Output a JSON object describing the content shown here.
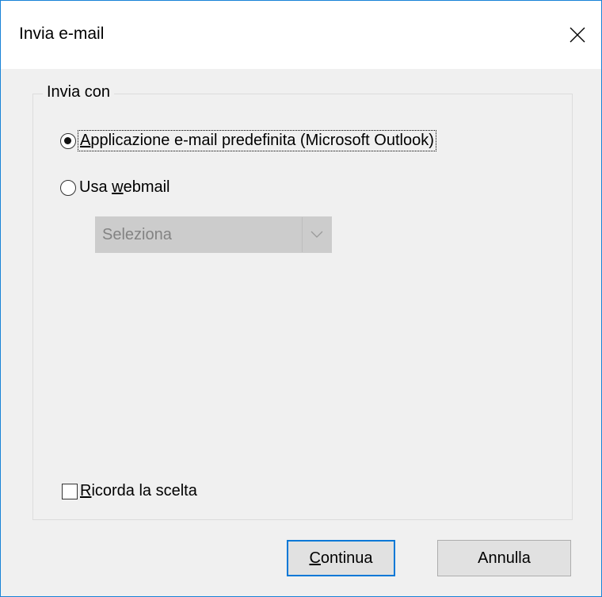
{
  "dialog": {
    "title": "Invia e-mail",
    "close_icon": "close-icon"
  },
  "send_with": {
    "legend": "Invia con",
    "options": [
      {
        "label_underlined": "A",
        "label_rest": "pplicazione e-mail predefinita (Microsoft Outlook)",
        "checked": true
      },
      {
        "label_prefix": "Usa ",
        "label_underlined": "w",
        "label_rest": "ebmail",
        "checked": false
      }
    ],
    "webmail_select": {
      "value": "Seleziona",
      "enabled": false,
      "arrow_icon": "chevron-down-icon"
    }
  },
  "remember": {
    "label_underlined": "R",
    "label_rest": "icorda la scelta",
    "checked": false
  },
  "buttons": {
    "continue_underlined": "C",
    "continue_rest": "ontinua",
    "cancel_label": "Annulla"
  },
  "colors": {
    "accent": "#0078d7",
    "window_border": "#1883d7",
    "dialog_bg": "#f0f0f0"
  }
}
